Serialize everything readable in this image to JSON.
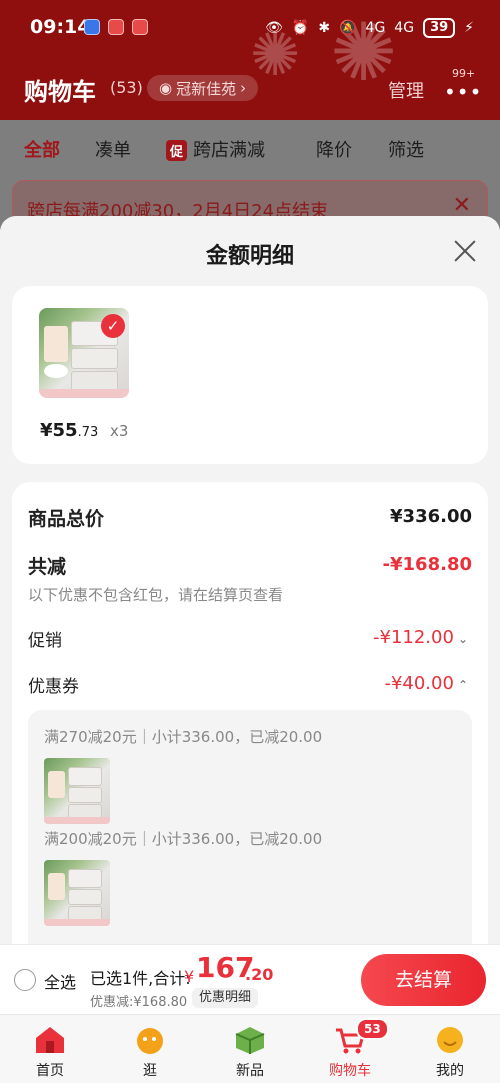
{
  "status_bar": {
    "time": "09:14",
    "network": "4G",
    "battery": "39"
  },
  "header": {
    "title": "购物车",
    "count": "(53)",
    "location": "冠新佳苑",
    "manage": "管理",
    "more_badge": "99+"
  },
  "tabs": [
    {
      "label": "全部"
    },
    {
      "label": "凑单"
    },
    {
      "label": "跨店满减",
      "chip": "促"
    },
    {
      "label": "降价"
    },
    {
      "label": "筛选"
    }
  ],
  "notice": {
    "text": "跨店每满200减30，2月4日24点结束"
  },
  "sheet": {
    "title": "金额明细",
    "item": {
      "price_main": "¥55",
      "price_dec": ".73",
      "quantity": "x3"
    },
    "rows": {
      "total_label": "商品总价",
      "total_value": "¥336.00",
      "reduce_label": "共减",
      "reduce_value": "-¥168.80",
      "reduce_note": "以下优惠不包含红包，请在结算页查看",
      "promo_label": "促销",
      "promo_value": "-¥112.00",
      "coupon_label": "优惠券",
      "coupon_value": "-¥40.00"
    },
    "coupons": [
      {
        "text": "满270减20元｜小计336.00，已减20.00"
      },
      {
        "text": "满200减20元｜小计336.00，已减20.00"
      }
    ]
  },
  "checkout": {
    "select_all": "全选",
    "summary": "已选1件,合计:",
    "currency": "¥",
    "total_int": "167",
    "total_dec": ".20",
    "discount": "优惠减:¥168.80",
    "detail_chip": "优惠明细",
    "button": "去结算"
  },
  "nav": {
    "items": [
      {
        "label": "首页"
      },
      {
        "label": "逛"
      },
      {
        "label": "新品"
      },
      {
        "label": "购物车",
        "badge": "53"
      },
      {
        "label": "我的"
      }
    ]
  },
  "colors": {
    "accent": "#e8313b",
    "header_bg": "#8f0f0f"
  }
}
